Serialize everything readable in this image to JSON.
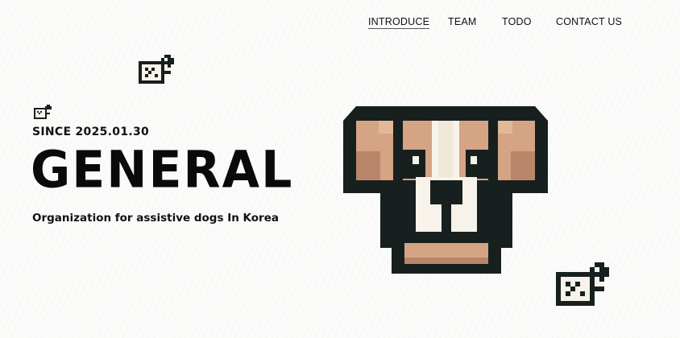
{
  "nav": {
    "items": [
      {
        "label": "INTRODUCE",
        "active": true
      },
      {
        "label": "TEAM",
        "active": false
      },
      {
        "label": "TODO",
        "active": false
      },
      {
        "label": "CONTACT US",
        "active": false
      }
    ]
  },
  "hero": {
    "since": "SINCE 2025.01.30",
    "title": "GENERAL",
    "subtitle": "Organization for assistive dogs In Korea"
  },
  "icons": {
    "hero_image": "pixel-dog-face-icon",
    "small_dog": "pixel-dog-icon"
  },
  "colors": {
    "background": "#fbfbfa",
    "text": "#111111",
    "dog_outline": "#17201e",
    "dog_fur": "#d4a484",
    "dog_fur_dark": "#b9866a",
    "dog_white": "#f7f3ea"
  }
}
